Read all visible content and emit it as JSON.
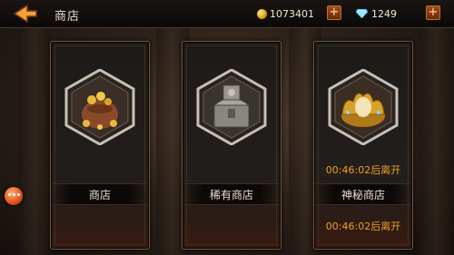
{
  "header": {
    "title": "商店",
    "gold": "1073401",
    "diamond": "1249",
    "plus_label": "+"
  },
  "shops": [
    {
      "label": "商店",
      "icon": "coin-sack-icon",
      "timer": ""
    },
    {
      "label": "稀有商店",
      "icon": "treasure-chest-icon",
      "timer": ""
    },
    {
      "label": "神秘商店",
      "icon": "golden-egg-icon",
      "timer": "00:46:02后离开"
    }
  ],
  "extra_timer": "00:46:02后离开",
  "colors": {
    "timer": "#f0a022",
    "accent": "#e05a1a",
    "frame": "#7a5a40"
  }
}
